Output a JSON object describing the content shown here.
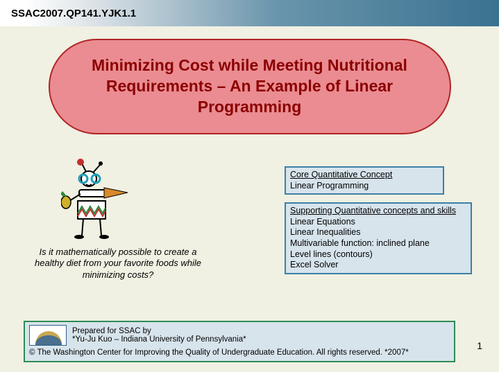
{
  "header_code": "SSAC2007.QP141.YJK1.1",
  "title": "Minimizing Cost while Meeting Nutritional Requirements – An Example of Linear Programming",
  "caption": "Is it mathematically possible to create a healthy diet from your favorite foods while minimizing costs?",
  "core_concept": {
    "heading": "Core Quantitative Concept",
    "items": [
      "Linear Programming"
    ]
  },
  "supporting": {
    "heading": "Supporting Quantitative concepts and skills",
    "items": [
      "Linear Equations",
      "Linear Inequalities",
      "Multivariable function: inclined plane",
      "Level lines (contours)",
      "Excel Solver"
    ]
  },
  "footer": {
    "line1": "Prepared for SSAC by",
    "line2": "*Yu-Ju Kuo – Indiana University of Pennsylvania*",
    "copyright": "© The Washington Center for Improving the Quality of Undergraduate Education. All rights reserved. *2007*"
  },
  "slide_number": "1"
}
